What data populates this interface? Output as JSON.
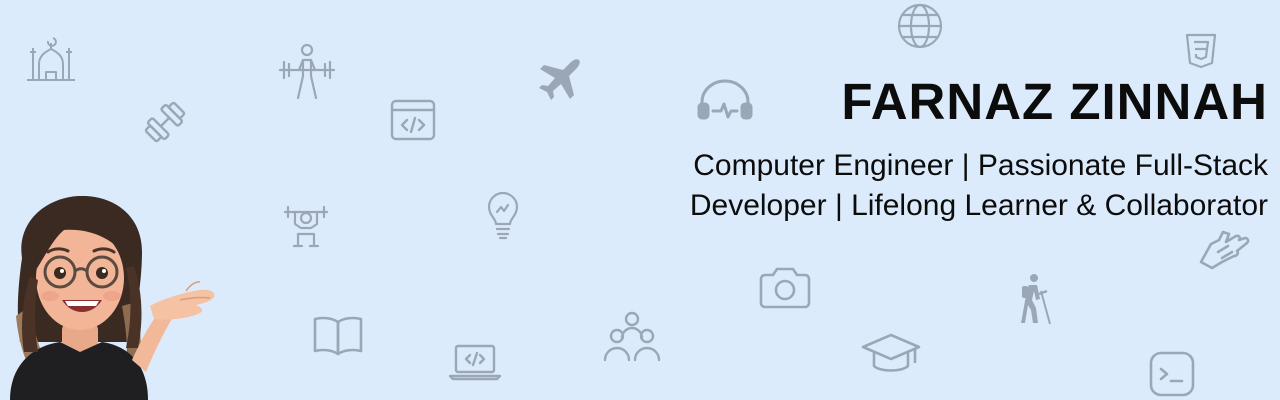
{
  "profile": {
    "name": "FARNAZ ZINNAH",
    "tagline_line1": "Computer Engineer | Passionate Full-Stack",
    "tagline_line2": "Developer | Lifelong Learner & Collaborator"
  },
  "icons": [
    "mosque-icon",
    "barbell-icon",
    "dumbbell-icon",
    "code-window-icon",
    "airplane-icon",
    "headphones-icon",
    "globe-icon",
    "css3-icon",
    "lightbulb-icon",
    "workout-icon",
    "camera-icon",
    "hiker-icon",
    "hand-icon",
    "book-icon",
    "laptop-code-icon",
    "people-icon",
    "graduation-cap-icon",
    "terminal-icon"
  ],
  "colors": {
    "background": "#dcebfb",
    "icon": "#9aa7b6",
    "text": "#0c0c0c"
  }
}
